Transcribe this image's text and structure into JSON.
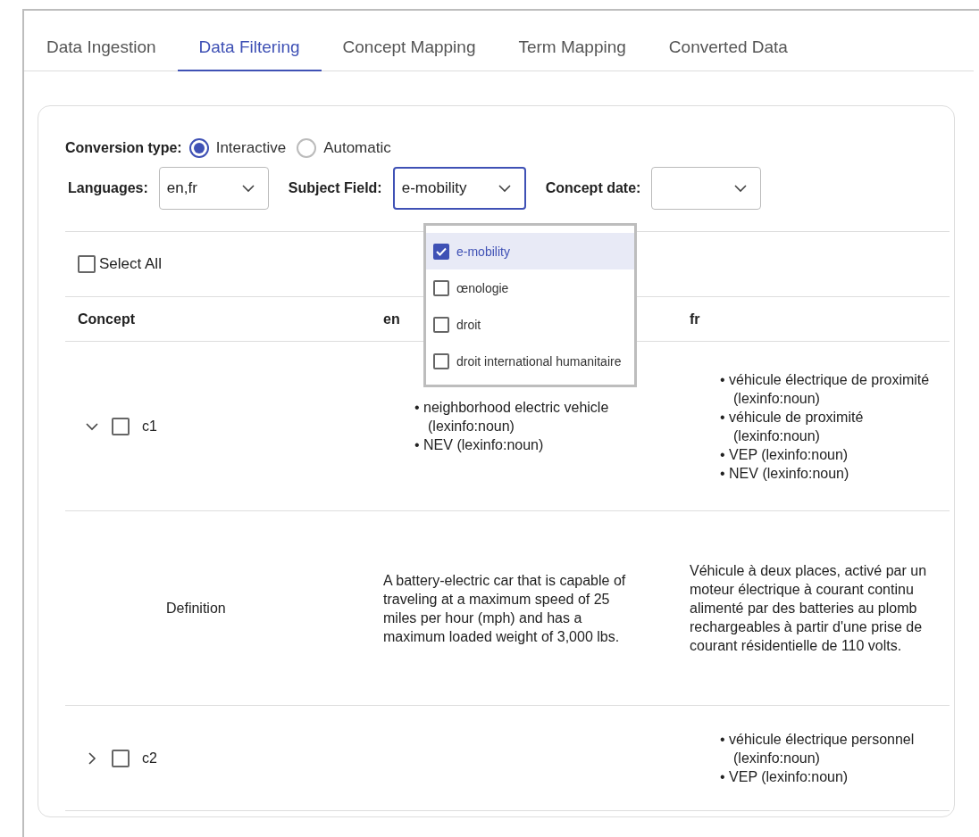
{
  "tabs": [
    {
      "label": "Data Ingestion",
      "selected": false
    },
    {
      "label": "Data Filtering",
      "selected": true
    },
    {
      "label": "Concept Mapping",
      "selected": false
    },
    {
      "label": "Term Mapping",
      "selected": false
    },
    {
      "label": "Converted Data",
      "selected": false
    }
  ],
  "conversion_type": {
    "label": "Conversion type:",
    "options": [
      {
        "label": "Interactive",
        "selected": true
      },
      {
        "label": "Automatic",
        "selected": false
      }
    ]
  },
  "filters": [
    {
      "label": "Languages:",
      "value": "en,fr",
      "focused": false
    },
    {
      "label": "Subject Field:",
      "value": "e-mobility",
      "focused": true
    },
    {
      "label": "Concept date:",
      "focused": false
    }
  ],
  "subject_menu": [
    {
      "label": "e-mobility",
      "checked": true,
      "selected": true
    },
    {
      "label": "œnologie",
      "checked": false,
      "selected": false
    },
    {
      "label": "droit",
      "checked": false,
      "selected": false
    },
    {
      "label": "droit international humanitaire",
      "checked": false,
      "selected": false
    }
  ],
  "select_all": {
    "label": "Select All",
    "checked": false
  },
  "table": {
    "columns": [
      "Concept",
      "en",
      "fr"
    ],
    "rows": [
      {
        "kind": "concept",
        "expanded": true,
        "checked": false,
        "label": "c1",
        "en": [
          "• neighborhood electric vehicle (lexinfo:noun)",
          "• NEV (lexinfo:noun)"
        ],
        "fr": [
          "• véhicule électrique de proximité (lexinfo:noun)",
          "• véhicule de proximité (lexinfo:noun)",
          "• VEP (lexinfo:noun)",
          "• NEV (lexinfo:noun)"
        ]
      },
      {
        "kind": "definition",
        "label": "Definition",
        "en": "A battery-electric car that is capable of traveling at a maximum speed of 25 miles per hour (mph) and has a maximum loaded weight of 3,000 lbs.",
        "fr": "Véhicule à deux places, activé par un moteur électrique à courant continu alimenté par des batteries au plomb rechargeables à partir d'une prise de courant résidentielle de 110 volts."
      },
      {
        "kind": "concept",
        "expanded": false,
        "checked": false,
        "label": "c2",
        "fr": [
          "• véhicule électrique personnel (lexinfo:noun)",
          "• VEP (lexinfo:noun)"
        ]
      }
    ]
  }
}
